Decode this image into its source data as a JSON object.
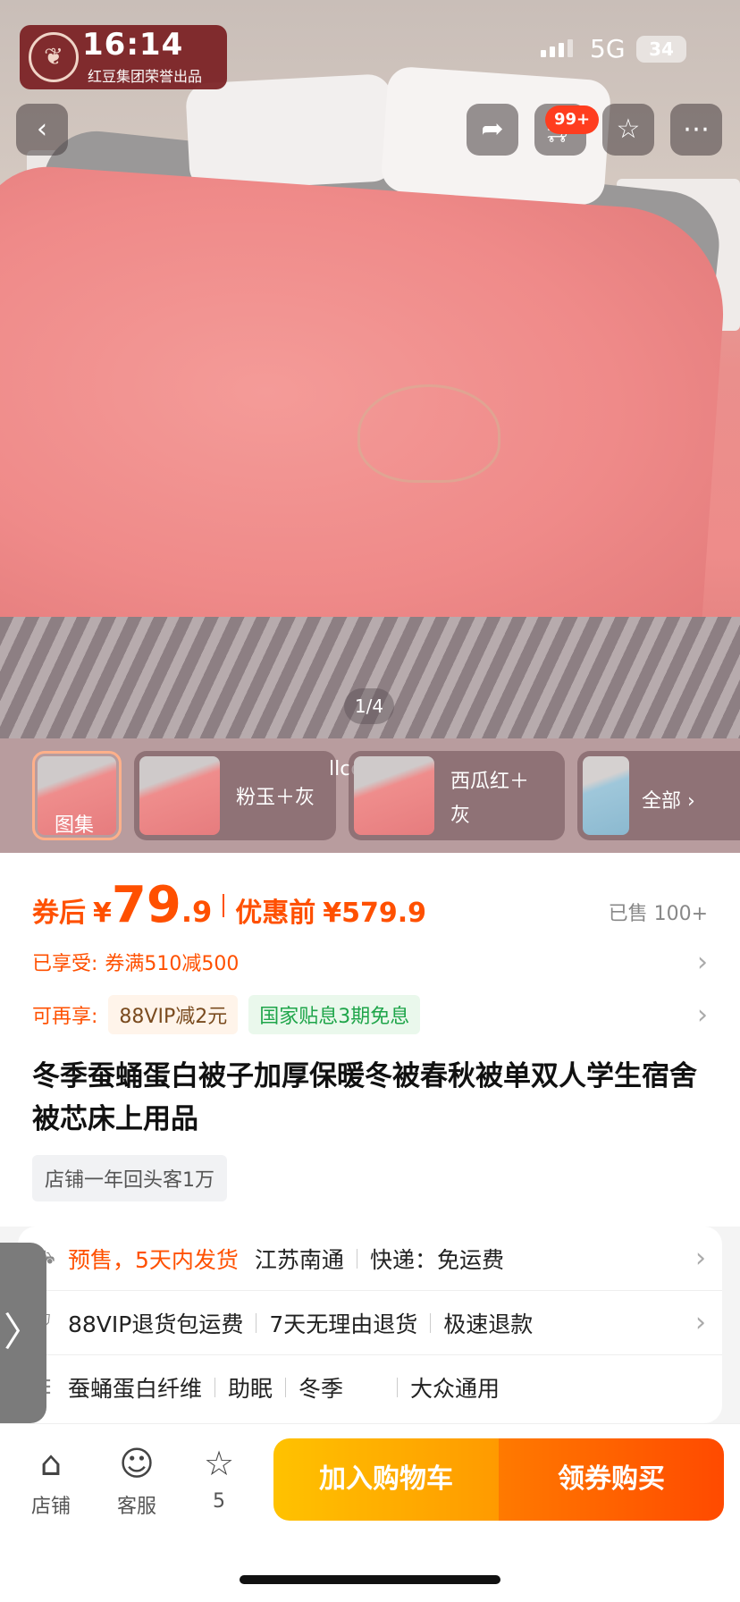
{
  "status_bar": {
    "time": "16:14",
    "network": "5G",
    "battery": "34"
  },
  "brand": {
    "name": "红豆",
    "tagline": "红豆集团荣誉出品"
  },
  "top_actions": {
    "cart_badge": "99+"
  },
  "gallery": {
    "counter": "1/4",
    "overlay_text": "llcc"
  },
  "thumbnails": [
    {
      "label": "图集"
    },
    {
      "label": "粉玉＋灰"
    },
    {
      "label": "西瓜红＋",
      "label2": "灰"
    },
    {
      "label": "全部"
    }
  ],
  "price": {
    "after_coupon_label": "券后",
    "currency": "¥",
    "integer": "79",
    "decimal": ".9",
    "before_label": "优惠前",
    "before_price": "¥579.9",
    "sold": "已售 100+"
  },
  "promotions": {
    "enjoyed_label": "已享受:",
    "enjoyed_value": "券满510减500",
    "available_label": "可再享:",
    "tags": [
      "88VIP减2元",
      "国家贴息3期免息"
    ]
  },
  "product": {
    "title": "冬季蚕蛹蛋白被子加厚保暖冬被春秋被单双人学生宿舍被芯床上用品",
    "shop_tag": "店铺一年回头客1万"
  },
  "service": {
    "shipping": [
      "预售，5天内发货",
      "江苏南通",
      "快递：免运费"
    ],
    "guarantee": [
      "88VIP退货包运费",
      "7天无理由退货",
      "极速退款"
    ],
    "params": [
      "蚕蛹蛋白纤维",
      "助眠",
      "冬季",
      "大众通用"
    ]
  },
  "bottom_bar": {
    "shop": "店铺",
    "service": "客服",
    "favorites_count": "5",
    "add_to_cart": "加入购物车",
    "buy": "领券购买"
  },
  "colors": {
    "accent": "#ff5000",
    "cart_button": "#ffb000",
    "buy_button": "#ff5a00"
  }
}
